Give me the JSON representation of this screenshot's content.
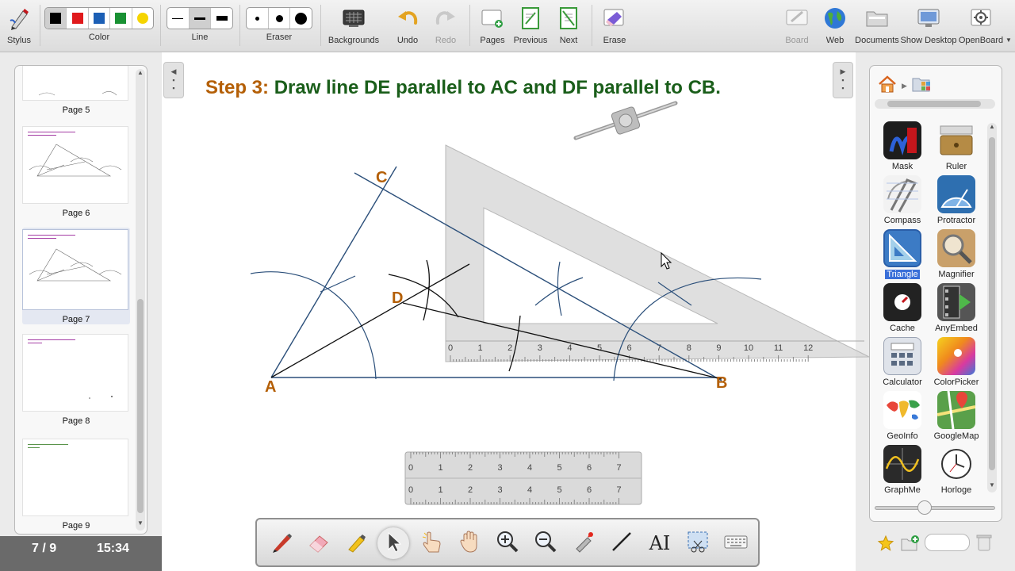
{
  "toolbar": {
    "stylus": "Stylus",
    "color": "Color",
    "line": "Line",
    "eraser": "Eraser",
    "backgrounds": "Backgrounds",
    "undo": "Undo",
    "redo": "Redo",
    "pages": "Pages",
    "previous": "Previous",
    "next": "Next",
    "erase": "Erase",
    "board": "Board",
    "web": "Web",
    "documents": "Documents",
    "show_desktop": "Show Desktop",
    "openboard": "OpenBoard",
    "colors": [
      "#000000",
      "#e0191c",
      "#1c5fb5",
      "#199133",
      "#f5d400"
    ],
    "selected_color_index": 0
  },
  "pages": {
    "labels": [
      "Page 5",
      "Page 6",
      "Page 7",
      "Page 8",
      "Page 9"
    ],
    "selected": "Page 7",
    "counter": "7 / 9",
    "clock": "15:34"
  },
  "board": {
    "title_lead": "Step 3:",
    "title_rest": "Draw line DE parallel to AC and DF parallel to CB.",
    "labels": {
      "A": "A",
      "B": "B",
      "C": "C",
      "D": "D"
    },
    "label_color": "#b45f06",
    "set_square_ticks": [
      "0",
      "1",
      "2",
      "3",
      "4",
      "5",
      "6",
      "7",
      "8",
      "9",
      "10",
      "11",
      "12"
    ],
    "ruler_ticks": [
      "0",
      "1",
      "2",
      "3",
      "4",
      "5",
      "6",
      "7"
    ]
  },
  "library": {
    "items": [
      {
        "label": "Mask",
        "icon": "mask-icon"
      },
      {
        "label": "Ruler",
        "icon": "ruler-icon"
      },
      {
        "label": "Compass",
        "icon": "compass-icon"
      },
      {
        "label": "Protractor",
        "icon": "protractor-icon"
      },
      {
        "label": "Triangle",
        "icon": "triangle-icon"
      },
      {
        "label": "Magnifier",
        "icon": "magnifier-icon"
      },
      {
        "label": "Cache",
        "icon": "cache-icon"
      },
      {
        "label": "AnyEmbed",
        "icon": "anyembed-icon"
      },
      {
        "label": "Calculator",
        "icon": "calculator-icon"
      },
      {
        "label": "ColorPicker",
        "icon": "colorpicker-icon"
      },
      {
        "label": "GeoInfo",
        "icon": "geoinfo-icon"
      },
      {
        "label": "GoogleMap",
        "icon": "googlemap-icon"
      },
      {
        "label": "GraphMe",
        "icon": "graphme-icon"
      },
      {
        "label": "Horloge",
        "icon": "horloge-icon"
      }
    ],
    "selected": "Triangle"
  }
}
